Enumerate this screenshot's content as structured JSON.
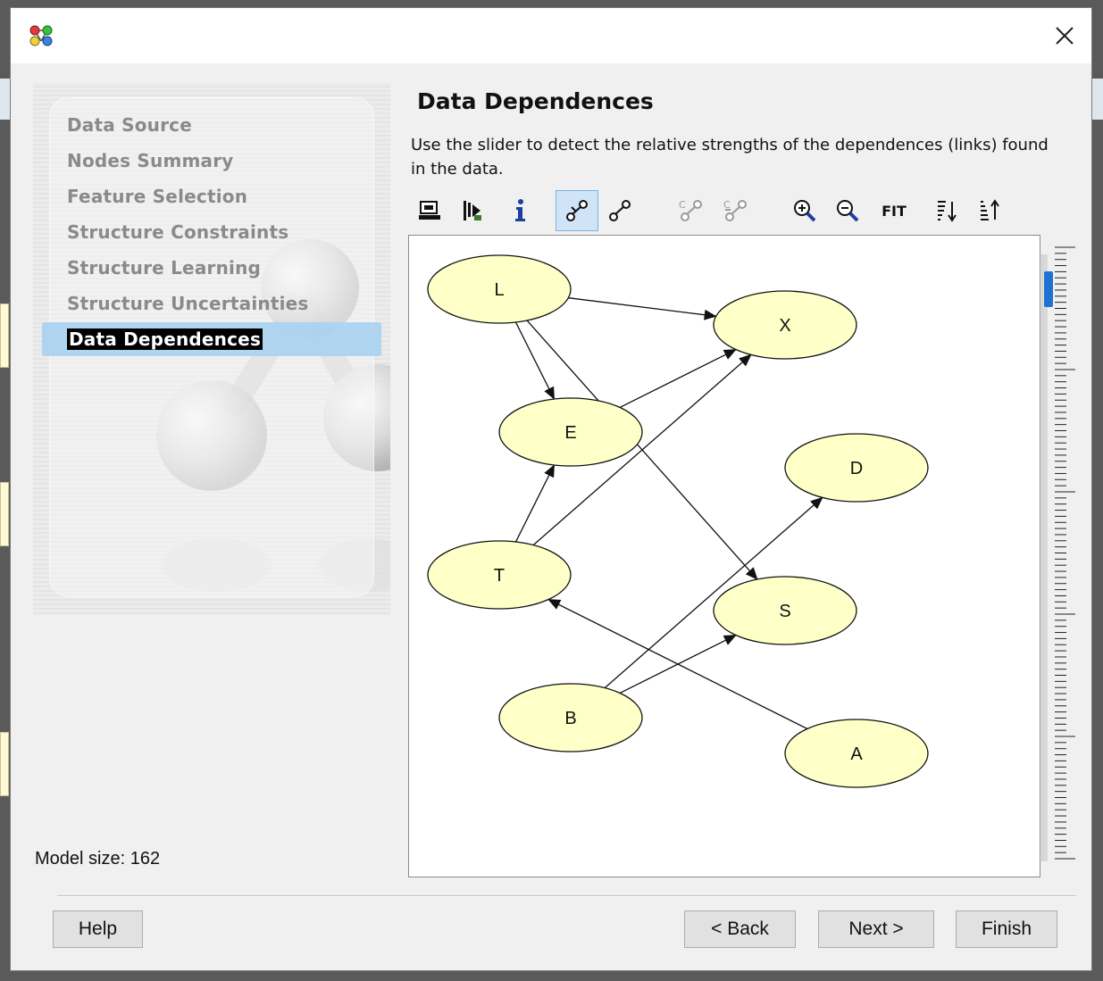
{
  "window": {
    "app_icon": "network-nodes-icon",
    "close_icon": "close-icon"
  },
  "steps": [
    {
      "label": "Data Source",
      "active": false
    },
    {
      "label": "Nodes Summary",
      "active": false
    },
    {
      "label": "Feature Selection",
      "active": false
    },
    {
      "label": "Structure Constraints",
      "active": false
    },
    {
      "label": "Structure Learning",
      "active": false
    },
    {
      "label": "Structure Uncertainties",
      "active": false
    },
    {
      "label": "Data Dependences",
      "active": true
    }
  ],
  "model_size_label": "Model size: 162",
  "page": {
    "heading": "Data Dependences",
    "description": "Use the slider to detect the relative strengths of the dependences (links) found in the data."
  },
  "toolbar": {
    "items": [
      {
        "icon": "export-image-icon"
      },
      {
        "icon": "run-check-icon"
      },
      {
        "icon": "info-icon"
      },
      {
        "icon": "link-strength-icon",
        "pressed": true
      },
      {
        "icon": "link-icon"
      },
      {
        "icon": "link-c-disabled-icon"
      },
      {
        "icon": "link-c-arrow-disabled-icon"
      },
      {
        "icon": "zoom-in-icon"
      },
      {
        "icon": "zoom-out-icon"
      },
      {
        "label": "FIT"
      },
      {
        "icon": "sort-descending-icon"
      },
      {
        "icon": "sort-ascending-icon"
      }
    ]
  },
  "graph": {
    "node_color": "#ffffc8",
    "nodes": [
      {
        "id": "L",
        "label": "L"
      },
      {
        "id": "X",
        "label": "X"
      },
      {
        "id": "E",
        "label": "E"
      },
      {
        "id": "D",
        "label": "D"
      },
      {
        "id": "T",
        "label": "T"
      },
      {
        "id": "S",
        "label": "S"
      },
      {
        "id": "B",
        "label": "B"
      },
      {
        "id": "A",
        "label": "A"
      }
    ],
    "edges": [
      {
        "from": "L",
        "to": "X"
      },
      {
        "from": "L",
        "to": "E"
      },
      {
        "from": "L",
        "to": "S"
      },
      {
        "from": "E",
        "to": "X"
      },
      {
        "from": "T",
        "to": "E"
      },
      {
        "from": "T",
        "to": "X"
      },
      {
        "from": "B",
        "to": "D"
      },
      {
        "from": "B",
        "to": "S"
      },
      {
        "from": "A",
        "to": "T"
      }
    ]
  },
  "slider": {
    "value_fraction": 0.03
  },
  "buttons": {
    "help": "Help",
    "back": "< Back",
    "next": "Next >",
    "finish": "Finish"
  }
}
